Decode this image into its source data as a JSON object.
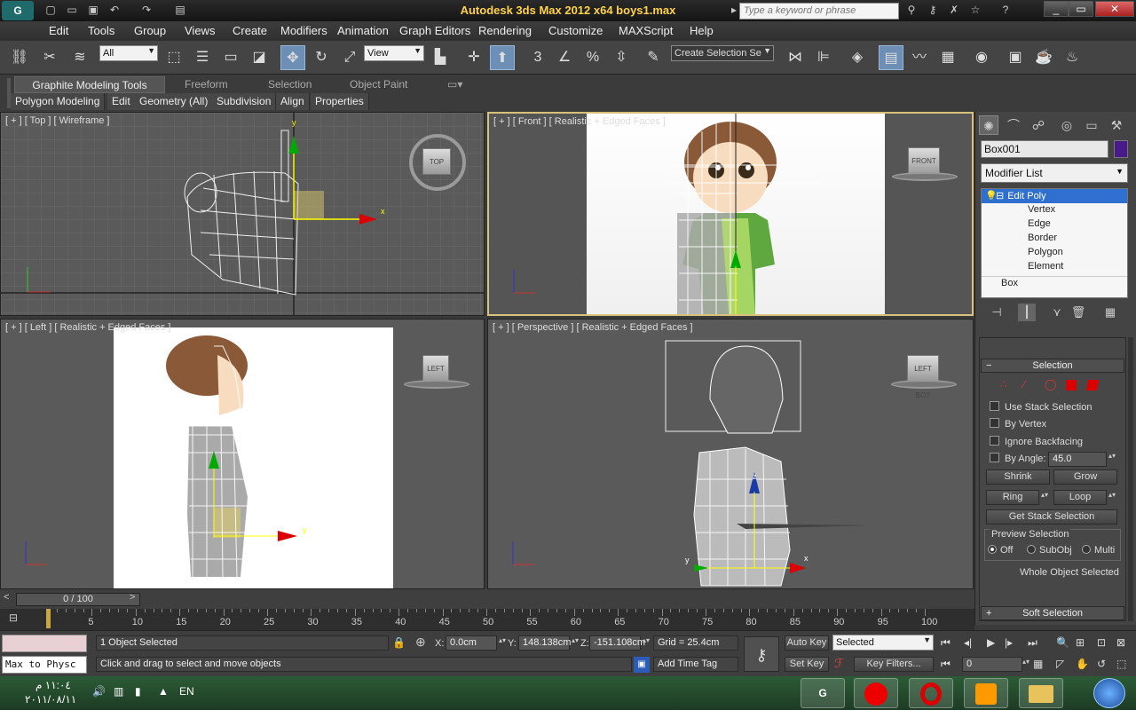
{
  "titlebar": {
    "title": "Autodesk 3ds Max  2012 x64     boys1.max",
    "search_placeholder": "Type a keyword or phrase"
  },
  "menu": [
    "Edit",
    "Tools",
    "Group",
    "Views",
    "Create",
    "Modifiers",
    "Animation",
    "Graph Editors",
    "Rendering",
    "Customize",
    "MAXScript",
    "Help"
  ],
  "toolbar": {
    "filter": "All",
    "ref_coord": "View",
    "selection_set": "Create Selection Se"
  },
  "ribbon": {
    "tabs": [
      "Graphite Modeling Tools",
      "Freeform",
      "Selection",
      "Object Paint"
    ],
    "subtabs": [
      "Polygon Modeling",
      "Edit",
      "Geometry (All)",
      "Subdivision",
      "Align",
      "Properties"
    ]
  },
  "viewports": {
    "top": {
      "label": "[ + ] [ Top ] [ Wireframe ]",
      "cube": "TOP"
    },
    "front": {
      "label": "[ + ] [ Front ] [ Realistic + Edged Faces ]",
      "cube": "FRONT"
    },
    "left": {
      "label": "[ + ] [ Left ] [ Realistic + Edged Faces ]",
      "cube": "LEFT"
    },
    "persp": {
      "label": "[ + ] [ Perspective ] [ Realistic + Edged Faces ]",
      "cube": "LEFT  BOY"
    }
  },
  "axis": {
    "x": "x",
    "y": "y",
    "z": "z"
  },
  "cmdpanel": {
    "object_name": "Box001",
    "color": "#4b1a8a",
    "modifier_list": "Modifier List",
    "stack": [
      "Edit Poly",
      "Vertex",
      "Edge",
      "Border",
      "Polygon",
      "Element",
      "Box"
    ],
    "selection_title": "Selection",
    "use_stack": "Use Stack Selection",
    "by_vertex": "By Vertex",
    "ignore_backfacing": "Ignore Backfacing",
    "by_angle": "By Angle:",
    "angle_value": "45.0",
    "shrink": "Shrink",
    "grow": "Grow",
    "ring": "Ring",
    "loop": "Loop",
    "get_stack": "Get Stack Selection",
    "preview_title": "Preview Selection",
    "preview_opts": [
      "Off",
      "SubObj",
      "Multi"
    ],
    "whole": "Whole Object Selected",
    "soft_sel": "Soft Selection"
  },
  "timeline": {
    "slider": "0 / 100",
    "ticks": [
      "5",
      "10",
      "15",
      "20",
      "25",
      "30",
      "35",
      "40",
      "45",
      "50",
      "55",
      "60",
      "65",
      "70",
      "75",
      "80",
      "85",
      "90",
      "95",
      "100"
    ]
  },
  "status": {
    "selected": "1 Object Selected",
    "prompt": "Click and drag to select and move objects",
    "listener": "Max to Physc",
    "x_label": "X:",
    "x_val": "0.0cm",
    "y_label": "Y:",
    "y_val": "148.138cm",
    "z_label": "Z:",
    "z_val": "-151.108cm",
    "grid": "Grid = 25.4cm",
    "add_time_tag": "Add Time Tag",
    "auto_key": "Auto Key",
    "set_key": "Set Key",
    "key_mode": "Selected",
    "key_filters": "Key Filters...",
    "frame": "0"
  },
  "taskbar": {
    "time": "١١:٠٤ م",
    "date": "٢٠١١/٠٨/١١",
    "lang": "EN"
  }
}
